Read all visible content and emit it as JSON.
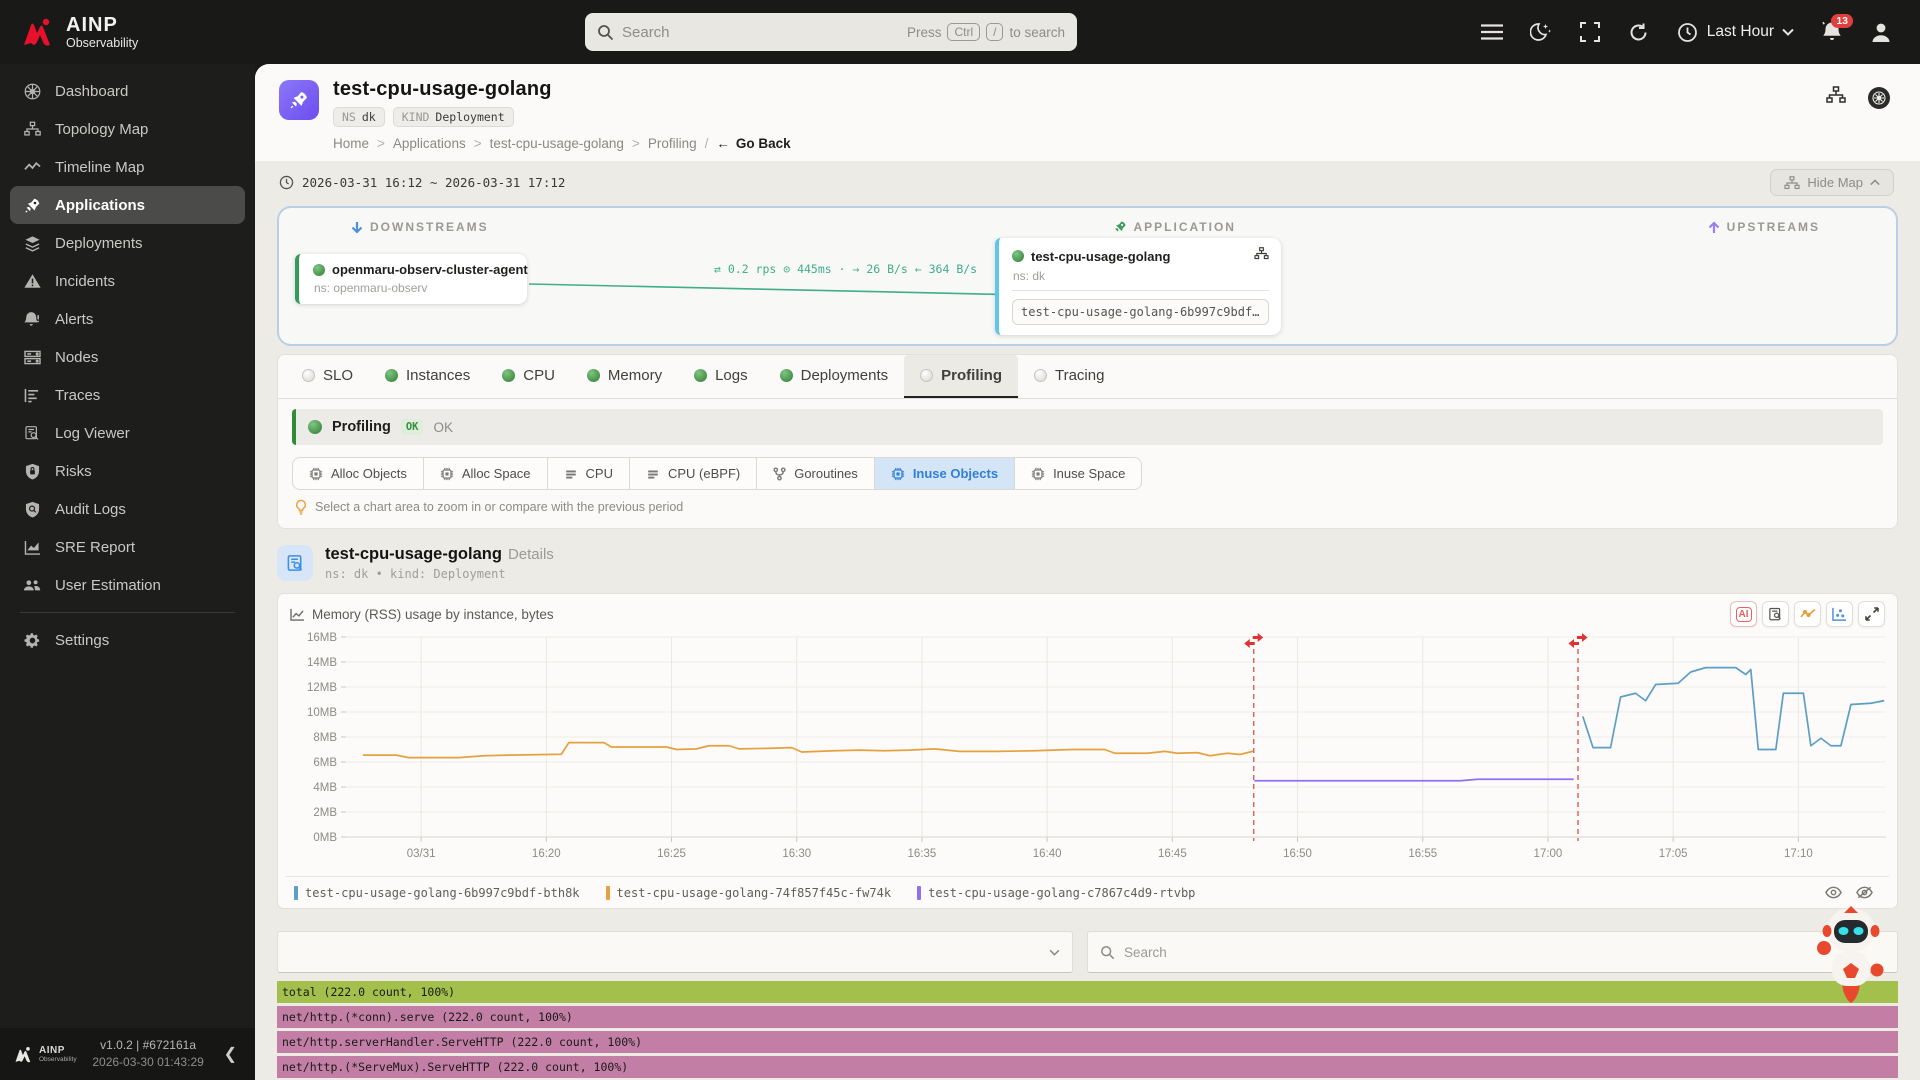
{
  "topbar": {
    "brand": {
      "name": "AINP",
      "sub": "Observability"
    },
    "search": {
      "placeholder": "Search",
      "press": "Press",
      "key_ctrl": "Ctrl",
      "key_slash": "/",
      "suffix": "to search"
    },
    "time_range_label": "Last Hour",
    "notification_count": "13"
  },
  "sidebar": {
    "items": [
      {
        "label": "Dashboard",
        "icon": "k8s",
        "active": false
      },
      {
        "label": "Topology Map",
        "icon": "topology",
        "active": false
      },
      {
        "label": "Timeline Map",
        "icon": "timeline",
        "active": false
      },
      {
        "label": "Applications",
        "icon": "rocket",
        "active": true
      },
      {
        "label": "Deployments",
        "icon": "layers",
        "active": false
      },
      {
        "label": "Incidents",
        "icon": "warning",
        "active": false
      },
      {
        "label": "Alerts",
        "icon": "bell",
        "active": false
      },
      {
        "label": "Nodes",
        "icon": "server",
        "active": false
      },
      {
        "label": "Traces",
        "icon": "traces",
        "active": false
      },
      {
        "label": "Log Viewer",
        "icon": "logview",
        "active": false
      },
      {
        "label": "Risks",
        "icon": "shield-lock",
        "active": false
      },
      {
        "label": "Audit Logs",
        "icon": "shield-search",
        "active": false
      },
      {
        "label": "SRE Report",
        "icon": "report",
        "active": false
      },
      {
        "label": "User Estimation",
        "icon": "users",
        "active": false
      }
    ],
    "settings_label": "Settings",
    "footer": {
      "brand_name": "AINP",
      "brand_sub": "Observability",
      "version": "v1.0.2 | #672161a",
      "build_time": "2026-03-30 01:43:29"
    }
  },
  "header": {
    "title": "test-cpu-usage-golang",
    "badges": [
      {
        "label": "NS",
        "value": "dk"
      },
      {
        "label": "KIND",
        "value": "Deployment"
      }
    ],
    "breadcrumb": {
      "items": [
        "Home",
        "Applications",
        "test-cpu-usage-golang",
        "Profiling"
      ],
      "sep": ">",
      "slash": "/"
    },
    "go_back": "Go Back",
    "time_range": "2026-03-31 16:12 ~ 2026-03-31 17:12",
    "hide_map_label": "Hide Map"
  },
  "map": {
    "downstreams_label": "DOWNSTREAMS",
    "application_label": "APPLICATION",
    "upstreams_label": "UPSTREAMS",
    "downstream_node": {
      "name": "openmaru-observ-cluster-agent",
      "ns": "ns: openmaru-observ"
    },
    "edge_label": "⇄ 0.2 rps  ⊙ 445ms  ·  → 26 B/s  ← 364 B/s",
    "app_node": {
      "name": "test-cpu-usage-golang",
      "ns": "ns: dk",
      "instance": "test-cpu-usage-golang-6b997c9bdf…"
    }
  },
  "tabs": [
    {
      "label": "SLO",
      "status": "gray",
      "active": false
    },
    {
      "label": "Instances",
      "status": "green",
      "active": false
    },
    {
      "label": "CPU",
      "status": "green",
      "active": false
    },
    {
      "label": "Memory",
      "status": "green",
      "active": false
    },
    {
      "label": "Logs",
      "status": "green",
      "active": false
    },
    {
      "label": "Deployments",
      "status": "green",
      "active": false
    },
    {
      "label": "Profiling",
      "status": "gray",
      "active": true
    },
    {
      "label": "Tracing",
      "status": "gray",
      "active": false
    }
  ],
  "profiling": {
    "title": "Profiling",
    "badge": "OK",
    "status_text": "OK",
    "profile_types": [
      {
        "label": "Alloc Objects",
        "icon": "chip",
        "active": false
      },
      {
        "label": "Alloc Space",
        "icon": "chip",
        "active": false
      },
      {
        "label": "CPU",
        "icon": "cpu",
        "active": false
      },
      {
        "label": "CPU (eBPF)",
        "icon": "cpu",
        "active": false
      },
      {
        "label": "Goroutines",
        "icon": "fork",
        "active": false
      },
      {
        "label": "Inuse Objects",
        "icon": "chip",
        "active": true
      },
      {
        "label": "Inuse Space",
        "icon": "chip",
        "active": false
      }
    ],
    "tip": "Select a chart area to zoom in or compare with the previous period"
  },
  "details": {
    "title": "test-cpu-usage-golang",
    "suffix": "Details",
    "subtitle": "ns: dk • kind: Deployment"
  },
  "chart_data": {
    "type": "line",
    "title": "Memory (RSS) usage by instance, bytes",
    "y_unit": "MB",
    "ylim": [
      0,
      16
    ],
    "y_tick_step": 2,
    "x_domain_minutes": [
      0,
      61.5
    ],
    "x_ticks": [
      {
        "min": 3,
        "label": "03/31"
      },
      {
        "min": 8,
        "label": "16:20"
      },
      {
        "min": 13,
        "label": "16:25"
      },
      {
        "min": 18,
        "label": "16:30"
      },
      {
        "min": 23,
        "label": "16:35"
      },
      {
        "min": 28,
        "label": "16:40"
      },
      {
        "min": 33,
        "label": "16:45"
      },
      {
        "min": 38,
        "label": "16:50"
      },
      {
        "min": 43,
        "label": "16:55"
      },
      {
        "min": 48,
        "label": "17:00"
      },
      {
        "min": 53,
        "label": "17:05"
      },
      {
        "min": 58,
        "label": "17:10"
      }
    ],
    "annotations": [
      {
        "type": "deploy-marker",
        "min": 36.25
      },
      {
        "type": "deploy-marker",
        "min": 49.2
      }
    ],
    "series": [
      {
        "name": "test-cpu-usage-golang-6b997c9bdf-bth8k",
        "color": "#5d9ec7",
        "points": [
          [
            49.4,
            9.6
          ],
          [
            49.8,
            7.15
          ],
          [
            50.5,
            7.15
          ],
          [
            50.9,
            11.2
          ],
          [
            51.5,
            11.5
          ],
          [
            51.9,
            10.9
          ],
          [
            52.3,
            12.2
          ],
          [
            53.2,
            12.3
          ],
          [
            53.7,
            13.2
          ],
          [
            54.3,
            13.55
          ],
          [
            55.5,
            13.55
          ],
          [
            55.9,
            13.0
          ],
          [
            56.1,
            13.4
          ],
          [
            56.4,
            7.0
          ],
          [
            57.1,
            7.0
          ],
          [
            57.4,
            11.5
          ],
          [
            58.2,
            11.5
          ],
          [
            58.5,
            7.3
          ],
          [
            58.9,
            7.9
          ],
          [
            59.3,
            7.3
          ],
          [
            59.7,
            7.3
          ],
          [
            60.1,
            10.6
          ],
          [
            60.9,
            10.7
          ],
          [
            61.4,
            10.9
          ]
        ]
      },
      {
        "name": "test-cpu-usage-golang-74f857f45c-fw74k",
        "color": "#e5a13e",
        "points": [
          [
            0.7,
            6.55
          ],
          [
            2,
            6.55
          ],
          [
            2.5,
            6.35
          ],
          [
            4.5,
            6.35
          ],
          [
            5.5,
            6.5
          ],
          [
            6.5,
            6.55
          ],
          [
            8,
            6.6
          ],
          [
            8.6,
            6.62
          ],
          [
            8.9,
            7.55
          ],
          [
            10.3,
            7.55
          ],
          [
            10.6,
            7.2
          ],
          [
            12.8,
            7.2
          ],
          [
            13.2,
            7.0
          ],
          [
            14,
            7.05
          ],
          [
            14.5,
            7.3
          ],
          [
            15.3,
            7.3
          ],
          [
            15.7,
            7.05
          ],
          [
            17,
            7.1
          ],
          [
            17.8,
            7.15
          ],
          [
            18.2,
            6.8
          ],
          [
            19.5,
            6.9
          ],
          [
            20.5,
            6.95
          ],
          [
            21.5,
            6.9
          ],
          [
            22.5,
            6.95
          ],
          [
            23.5,
            7.05
          ],
          [
            24.5,
            6.85
          ],
          [
            26,
            6.85
          ],
          [
            27.5,
            6.9
          ],
          [
            29,
            7.0
          ],
          [
            30.3,
            7.0
          ],
          [
            30.7,
            6.7
          ],
          [
            32,
            6.7
          ],
          [
            32.7,
            6.85
          ],
          [
            33.2,
            6.7
          ],
          [
            34,
            6.75
          ],
          [
            34.5,
            6.5
          ],
          [
            35.2,
            6.7
          ],
          [
            35.7,
            6.6
          ],
          [
            36.2,
            6.85
          ]
        ]
      },
      {
        "name": "test-cpu-usage-golang-c7867c4d9-rtvbp",
        "color": "#9070f2",
        "points": [
          [
            36.3,
            4.5
          ],
          [
            44.5,
            4.5
          ],
          [
            45.2,
            4.62
          ],
          [
            49.0,
            4.62
          ]
        ]
      }
    ],
    "legend_position": "bottom",
    "grid": true
  },
  "controls": {
    "search_placeholder": "Search"
  },
  "flame": {
    "rows": [
      {
        "fn": "total",
        "stat": "(222.0 count, 100%)",
        "color": "#a2c04b"
      },
      {
        "fn": "net/http.(*conn).serve",
        "stat": "(222.0 count, 100%)",
        "color": "#c27ea5"
      },
      {
        "fn": "net/http.serverHandler.ServeHTTP",
        "stat": "(222.0 count, 100%)",
        "color": "#c27ea5"
      },
      {
        "fn": "net/http.(*ServeMux).ServeHTTP",
        "stat": "(222.0 count, 100%)",
        "color": "#c27ea5"
      }
    ]
  }
}
